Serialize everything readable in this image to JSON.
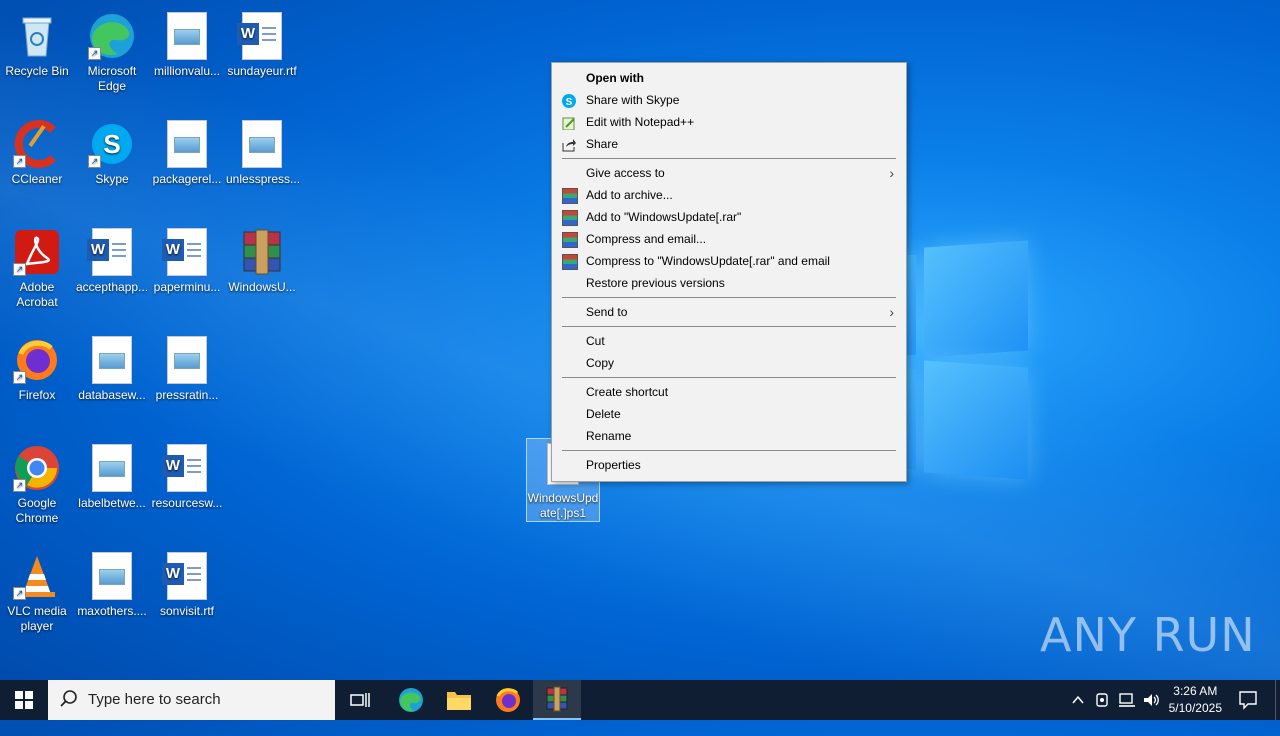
{
  "desktop": {
    "icons": [
      {
        "label": "Recycle Bin"
      },
      {
        "label": "Microsoft Edge"
      },
      {
        "label": "millionvalu..."
      },
      {
        "label": "sundayeur.rtf"
      },
      {
        "label": "CCleaner"
      },
      {
        "label": "Skype"
      },
      {
        "label": "packagerel..."
      },
      {
        "label": "unlesspress..."
      },
      {
        "label": "Adobe Acrobat"
      },
      {
        "label": "accepthapp..."
      },
      {
        "label": "paperminu..."
      },
      {
        "label": "WindowsU..."
      },
      {
        "label": "Firefox"
      },
      {
        "label": "databasew..."
      },
      {
        "label": "pressratin..."
      },
      {
        "label": "Google Chrome"
      },
      {
        "label": "labelbetwe..."
      },
      {
        "label": "resourcesw..."
      },
      {
        "label": "VLC media player"
      },
      {
        "label": "maxothers...."
      },
      {
        "label": "sonvisit.rtf"
      }
    ],
    "selected_file": {
      "label": "WindowsUpdate[.]ps1"
    }
  },
  "context_menu": {
    "items": [
      {
        "label": "Open with"
      },
      {
        "label": "Share with Skype"
      },
      {
        "label": "Edit with Notepad++"
      },
      {
        "label": "Share"
      },
      {
        "label": "Give access to"
      },
      {
        "label": "Add to archive..."
      },
      {
        "label": "Add to \"WindowsUpdate[.rar\""
      },
      {
        "label": "Compress and email..."
      },
      {
        "label": "Compress to \"WindowsUpdate[.rar\" and email"
      },
      {
        "label": "Restore previous versions"
      },
      {
        "label": "Send to"
      },
      {
        "label": "Cut"
      },
      {
        "label": "Copy"
      },
      {
        "label": "Create shortcut"
      },
      {
        "label": "Delete"
      },
      {
        "label": "Rename"
      },
      {
        "label": "Properties"
      }
    ]
  },
  "taskbar": {
    "search_placeholder": "Type here to search",
    "time": "3:26 AM",
    "date": "5/10/2025"
  },
  "watermark": "ANY RUN",
  "colors": {
    "accent": "#0078d7",
    "taskbar": "#0f1e33",
    "menu_bg": "#f2f2f2"
  }
}
